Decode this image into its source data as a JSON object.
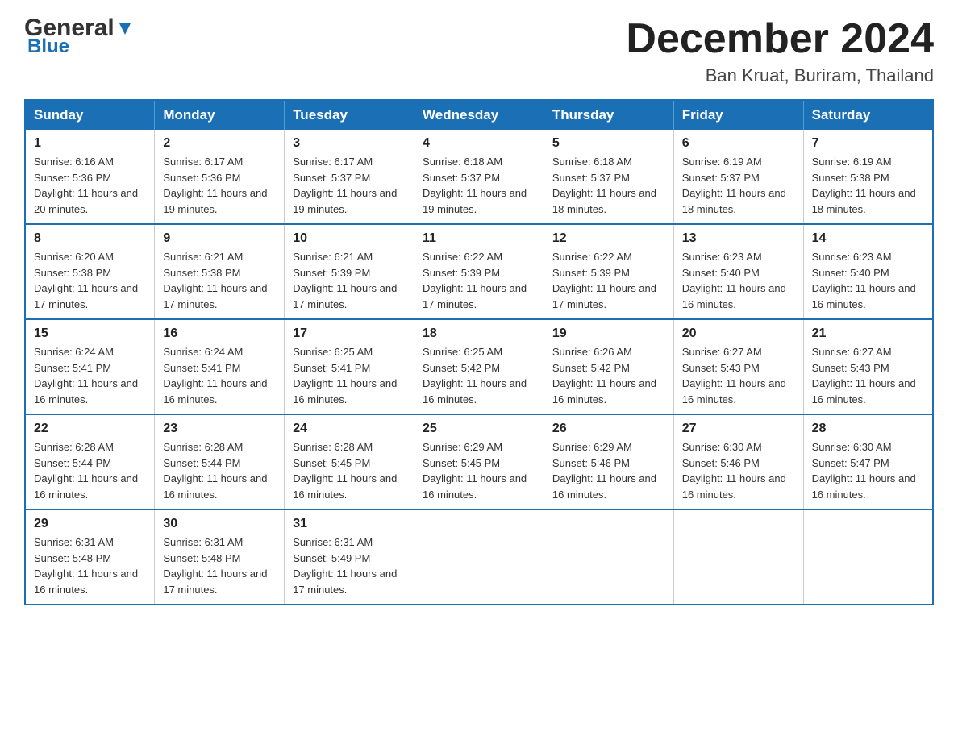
{
  "header": {
    "logo_general": "General",
    "logo_blue": "Blue",
    "title": "December 2024",
    "location": "Ban Kruat, Buriram, Thailand"
  },
  "columns": [
    "Sunday",
    "Monday",
    "Tuesday",
    "Wednesday",
    "Thursday",
    "Friday",
    "Saturday"
  ],
  "weeks": [
    [
      {
        "day": "1",
        "sunrise": "6:16 AM",
        "sunset": "5:36 PM",
        "daylight": "11 hours and 20 minutes."
      },
      {
        "day": "2",
        "sunrise": "6:17 AM",
        "sunset": "5:36 PM",
        "daylight": "11 hours and 19 minutes."
      },
      {
        "day": "3",
        "sunrise": "6:17 AM",
        "sunset": "5:37 PM",
        "daylight": "11 hours and 19 minutes."
      },
      {
        "day": "4",
        "sunrise": "6:18 AM",
        "sunset": "5:37 PM",
        "daylight": "11 hours and 19 minutes."
      },
      {
        "day": "5",
        "sunrise": "6:18 AM",
        "sunset": "5:37 PM",
        "daylight": "11 hours and 18 minutes."
      },
      {
        "day": "6",
        "sunrise": "6:19 AM",
        "sunset": "5:37 PM",
        "daylight": "11 hours and 18 minutes."
      },
      {
        "day": "7",
        "sunrise": "6:19 AM",
        "sunset": "5:38 PM",
        "daylight": "11 hours and 18 minutes."
      }
    ],
    [
      {
        "day": "8",
        "sunrise": "6:20 AM",
        "sunset": "5:38 PM",
        "daylight": "11 hours and 17 minutes."
      },
      {
        "day": "9",
        "sunrise": "6:21 AM",
        "sunset": "5:38 PM",
        "daylight": "11 hours and 17 minutes."
      },
      {
        "day": "10",
        "sunrise": "6:21 AM",
        "sunset": "5:39 PM",
        "daylight": "11 hours and 17 minutes."
      },
      {
        "day": "11",
        "sunrise": "6:22 AM",
        "sunset": "5:39 PM",
        "daylight": "11 hours and 17 minutes."
      },
      {
        "day": "12",
        "sunrise": "6:22 AM",
        "sunset": "5:39 PM",
        "daylight": "11 hours and 17 minutes."
      },
      {
        "day": "13",
        "sunrise": "6:23 AM",
        "sunset": "5:40 PM",
        "daylight": "11 hours and 16 minutes."
      },
      {
        "day": "14",
        "sunrise": "6:23 AM",
        "sunset": "5:40 PM",
        "daylight": "11 hours and 16 minutes."
      }
    ],
    [
      {
        "day": "15",
        "sunrise": "6:24 AM",
        "sunset": "5:41 PM",
        "daylight": "11 hours and 16 minutes."
      },
      {
        "day": "16",
        "sunrise": "6:24 AM",
        "sunset": "5:41 PM",
        "daylight": "11 hours and 16 minutes."
      },
      {
        "day": "17",
        "sunrise": "6:25 AM",
        "sunset": "5:41 PM",
        "daylight": "11 hours and 16 minutes."
      },
      {
        "day": "18",
        "sunrise": "6:25 AM",
        "sunset": "5:42 PM",
        "daylight": "11 hours and 16 minutes."
      },
      {
        "day": "19",
        "sunrise": "6:26 AM",
        "sunset": "5:42 PM",
        "daylight": "11 hours and 16 minutes."
      },
      {
        "day": "20",
        "sunrise": "6:27 AM",
        "sunset": "5:43 PM",
        "daylight": "11 hours and 16 minutes."
      },
      {
        "day": "21",
        "sunrise": "6:27 AM",
        "sunset": "5:43 PM",
        "daylight": "11 hours and 16 minutes."
      }
    ],
    [
      {
        "day": "22",
        "sunrise": "6:28 AM",
        "sunset": "5:44 PM",
        "daylight": "11 hours and 16 minutes."
      },
      {
        "day": "23",
        "sunrise": "6:28 AM",
        "sunset": "5:44 PM",
        "daylight": "11 hours and 16 minutes."
      },
      {
        "day": "24",
        "sunrise": "6:28 AM",
        "sunset": "5:45 PM",
        "daylight": "11 hours and 16 minutes."
      },
      {
        "day": "25",
        "sunrise": "6:29 AM",
        "sunset": "5:45 PM",
        "daylight": "11 hours and 16 minutes."
      },
      {
        "day": "26",
        "sunrise": "6:29 AM",
        "sunset": "5:46 PM",
        "daylight": "11 hours and 16 minutes."
      },
      {
        "day": "27",
        "sunrise": "6:30 AM",
        "sunset": "5:46 PM",
        "daylight": "11 hours and 16 minutes."
      },
      {
        "day": "28",
        "sunrise": "6:30 AM",
        "sunset": "5:47 PM",
        "daylight": "11 hours and 16 minutes."
      }
    ],
    [
      {
        "day": "29",
        "sunrise": "6:31 AM",
        "sunset": "5:48 PM",
        "daylight": "11 hours and 16 minutes."
      },
      {
        "day": "30",
        "sunrise": "6:31 AM",
        "sunset": "5:48 PM",
        "daylight": "11 hours and 17 minutes."
      },
      {
        "day": "31",
        "sunrise": "6:31 AM",
        "sunset": "5:49 PM",
        "daylight": "11 hours and 17 minutes."
      },
      null,
      null,
      null,
      null
    ]
  ]
}
